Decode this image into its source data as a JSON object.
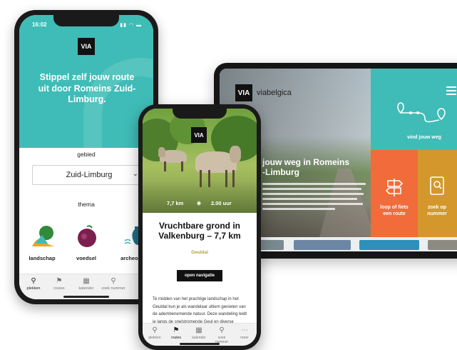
{
  "tablet": {
    "logo": "VIA",
    "brand": "viabelgica",
    "headline_line1": "jouw weg in Romeins",
    "headline_line2": "-Limburg",
    "tile_find_route": "vind jouw weg",
    "tile_walk_bike_line1": "loop of fiets",
    "tile_walk_bike_line2": "een route",
    "tile_search_line1": "zoek op",
    "tile_search_line2": "nummer",
    "colors": {
      "teal": "#3fbcb7",
      "orange": "#f26b3a",
      "mustard": "#d3972b"
    }
  },
  "left_phone": {
    "status_time": "16:02",
    "logo": "VIA",
    "hero_title": "Stippel zelf jouw route uit door Romeins Zuid-Limburg.",
    "region_label": "gebied",
    "region_value": "Zuid-Limburg",
    "theme_label": "thema",
    "themes": [
      "landschap",
      "voedsel",
      "archeolog"
    ],
    "nav": [
      "plekken",
      "routes",
      "kalender",
      "zoek nummer",
      "me"
    ]
  },
  "center_phone": {
    "logo": "VIA",
    "distance": "7,7 km",
    "duration": "2.00 uur",
    "title": "Vruchtbare grond in Valkenburg – 7,7 km",
    "subtitle": "Geuldal",
    "button": "open navigatie",
    "body": "Te midden van het prachtige landschap in het Geuldal kun je als wandelaar ultiem genieten van de adembenemende natuur. Deze wandeling leidt je langs de snelstromende Geul en diverse",
    "nav": [
      "plekken",
      "routes",
      "kalender",
      "zoek nummer",
      "meer"
    ]
  }
}
